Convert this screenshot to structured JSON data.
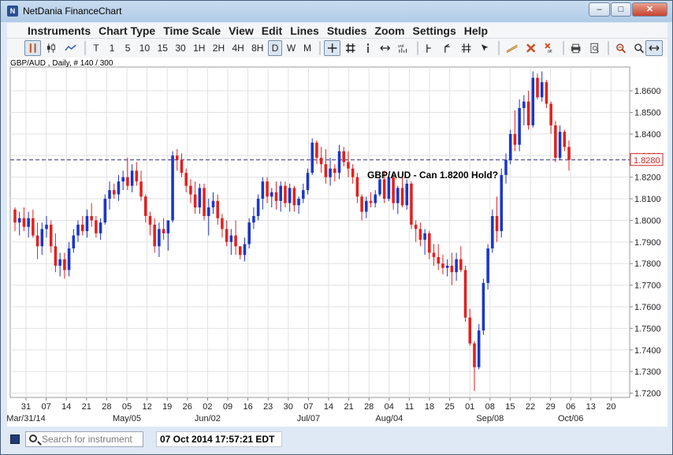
{
  "window": {
    "title": "NetDania FinanceChart",
    "controls": {
      "minimize": "–",
      "maximize": "□",
      "close": "✕"
    }
  },
  "menu": {
    "items": [
      "Instruments",
      "Chart Type",
      "Time Scale",
      "View",
      "Edit",
      "Lines",
      "Studies",
      "Zoom",
      "Settings",
      "Help"
    ]
  },
  "toolbar": {
    "chart_types": [
      "bar-chart-icon",
      "candlestick-icon",
      "line-chart-icon"
    ],
    "timescales": [
      "T",
      "1",
      "5",
      "10",
      "15",
      "30",
      "1H",
      "2H",
      "4H",
      "8H",
      "D",
      "W",
      "M"
    ],
    "active_timescale": "D",
    "tools": [
      "crosshair-icon",
      "grid-icon",
      "info-icon",
      "pan-icon",
      "volume-icon",
      "line-tool-icon",
      "fork-tool-icon",
      "fib-tool-icon",
      "cursor-tool-icon",
      "trendline-icon",
      "delete-icon",
      "delete-all-icon",
      "print-icon",
      "print-preview-icon",
      "zoom-out-icon",
      "zoom-reset-icon",
      "zoom-in-icon",
      "expand-icon"
    ]
  },
  "chart_header": "GBP/AUD , Daily, # 140 / 300",
  "status": {
    "search_placeholder": "Search for instrument",
    "timestamp": "07 Oct 2014 17:57:21 EDT"
  },
  "chart_data": {
    "type": "candlestick",
    "instrument": "GBP/AUD",
    "annotation": "GBP/AUD - Can 1.8200 Hold?",
    "last_price": "1.8280",
    "ylim": [
      1.718,
      1.871
    ],
    "yticks": [
      "1.7200",
      "1.7300",
      "1.7400",
      "1.7500",
      "1.7600",
      "1.7700",
      "1.7800",
      "1.7900",
      "1.8000",
      "1.8100",
      "1.8200",
      "1.8300",
      "1.8400",
      "1.8500",
      "1.8600"
    ],
    "xticks": [
      "31",
      "07",
      "14",
      "21",
      "28",
      "05",
      "12",
      "19",
      "26",
      "02",
      "09",
      "16",
      "23",
      "30",
      "07",
      "14",
      "21",
      "28",
      "04",
      "11",
      "18",
      "25",
      "01",
      "08",
      "15",
      "22",
      "29",
      "06",
      "13",
      "20"
    ],
    "month_labels": [
      {
        "label": "Mar/31/14",
        "tick_index": 0
      },
      {
        "label": "May/05",
        "tick_index": 5
      },
      {
        "label": "Jun/02",
        "tick_index": 9
      },
      {
        "label": "Jul/07",
        "tick_index": 14
      },
      {
        "label": "Aug/04",
        "tick_index": 18
      },
      {
        "label": "Sep/08",
        "tick_index": 23
      },
      {
        "label": "Oct/06",
        "tick_index": 27
      }
    ],
    "horizontal_line": 1.828,
    "candles": [
      [
        1.805,
        1.806,
        1.795,
        1.799
      ],
      [
        1.799,
        1.804,
        1.793,
        1.801
      ],
      [
        1.801,
        1.806,
        1.795,
        1.797
      ],
      [
        1.797,
        1.804,
        1.792,
        1.801
      ],
      [
        1.801,
        1.805,
        1.792,
        1.793
      ],
      [
        1.793,
        1.799,
        1.782,
        1.788
      ],
      [
        1.788,
        1.799,
        1.784,
        1.796
      ],
      [
        1.796,
        1.802,
        1.792,
        1.798
      ],
      [
        1.798,
        1.8,
        1.785,
        1.788
      ],
      [
        1.788,
        1.794,
        1.776,
        1.779
      ],
      [
        1.779,
        1.785,
        1.774,
        1.782
      ],
      [
        1.782,
        1.785,
        1.773,
        1.777
      ],
      [
        1.777,
        1.79,
        1.774,
        1.787
      ],
      [
        1.787,
        1.796,
        1.785,
        1.793
      ],
      [
        1.793,
        1.8,
        1.79,
        1.798
      ],
      [
        1.798,
        1.802,
        1.793,
        1.795
      ],
      [
        1.795,
        1.805,
        1.792,
        1.802
      ],
      [
        1.802,
        1.808,
        1.797,
        1.8
      ],
      [
        1.8,
        1.802,
        1.792,
        1.794
      ],
      [
        1.794,
        1.801,
        1.791,
        1.799
      ],
      [
        1.799,
        1.812,
        1.798,
        1.81
      ],
      [
        1.81,
        1.818,
        1.805,
        1.814
      ],
      [
        1.814,
        1.817,
        1.81,
        1.812
      ],
      [
        1.812,
        1.821,
        1.809,
        1.818
      ],
      [
        1.818,
        1.823,
        1.814,
        1.82
      ],
      [
        1.82,
        1.829,
        1.814,
        1.816
      ],
      [
        1.816,
        1.826,
        1.813,
        1.823
      ],
      [
        1.823,
        1.827,
        1.816,
        1.818
      ],
      [
        1.818,
        1.823,
        1.809,
        1.811
      ],
      [
        1.811,
        1.812,
        1.799,
        1.802
      ],
      [
        1.802,
        1.804,
        1.793,
        1.798
      ],
      [
        1.798,
        1.801,
        1.785,
        1.788
      ],
      [
        1.788,
        1.799,
        1.783,
        1.796
      ],
      [
        1.796,
        1.801,
        1.791,
        1.794
      ],
      [
        1.794,
        1.798,
        1.786,
        1.8
      ],
      [
        1.8,
        1.832,
        1.799,
        1.83
      ],
      [
        1.83,
        1.833,
        1.823,
        1.828
      ],
      [
        1.828,
        1.831,
        1.82,
        1.822
      ],
      [
        1.822,
        1.824,
        1.813,
        1.816
      ],
      [
        1.816,
        1.819,
        1.808,
        1.812
      ],
      [
        1.812,
        1.818,
        1.803,
        1.806
      ],
      [
        1.806,
        1.817,
        1.803,
        1.815
      ],
      [
        1.815,
        1.817,
        1.8,
        1.802
      ],
      [
        1.802,
        1.81,
        1.793,
        1.806
      ],
      [
        1.806,
        1.813,
        1.803,
        1.809
      ],
      [
        1.809,
        1.812,
        1.798,
        1.801
      ],
      [
        1.801,
        1.803,
        1.792,
        1.796
      ],
      [
        1.796,
        1.8,
        1.788,
        1.79
      ],
      [
        1.79,
        1.796,
        1.784,
        1.793
      ],
      [
        1.793,
        1.8,
        1.784,
        1.788
      ],
      [
        1.788,
        1.788,
        1.782,
        1.784
      ],
      [
        1.784,
        1.792,
        1.781,
        1.789
      ],
      [
        1.789,
        1.801,
        1.787,
        1.799
      ],
      [
        1.799,
        1.806,
        1.796,
        1.802
      ],
      [
        1.802,
        1.812,
        1.8,
        1.81
      ],
      [
        1.81,
        1.82,
        1.805,
        1.818
      ],
      [
        1.818,
        1.82,
        1.808,
        1.811
      ],
      [
        1.811,
        1.815,
        1.806,
        1.813
      ],
      [
        1.813,
        1.818,
        1.805,
        1.809
      ],
      [
        1.809,
        1.818,
        1.804,
        1.816
      ],
      [
        1.816,
        1.818,
        1.806,
        1.808
      ],
      [
        1.808,
        1.817,
        1.804,
        1.815
      ],
      [
        1.815,
        1.816,
        1.804,
        1.807
      ],
      [
        1.807,
        1.811,
        1.803,
        1.81
      ],
      [
        1.81,
        1.817,
        1.808,
        1.814
      ],
      [
        1.814,
        1.824,
        1.812,
        1.822
      ],
      [
        1.822,
        1.838,
        1.821,
        1.836
      ],
      [
        1.836,
        1.837,
        1.826,
        1.829
      ],
      [
        1.829,
        1.834,
        1.822,
        1.826
      ],
      [
        1.826,
        1.833,
        1.817,
        1.82
      ],
      [
        1.82,
        1.829,
        1.816,
        1.824
      ],
      [
        1.824,
        1.826,
        1.818,
        1.822
      ],
      [
        1.822,
        1.835,
        1.819,
        1.832
      ],
      [
        1.832,
        1.834,
        1.825,
        1.827
      ],
      [
        1.827,
        1.832,
        1.82,
        1.824
      ],
      [
        1.824,
        1.826,
        1.817,
        1.82
      ],
      [
        1.82,
        1.822,
        1.808,
        1.811
      ],
      [
        1.811,
        1.812,
        1.8,
        1.804
      ],
      [
        1.804,
        1.811,
        1.801,
        1.809
      ],
      [
        1.809,
        1.813,
        1.806,
        1.808
      ],
      [
        1.808,
        1.814,
        1.806,
        1.812
      ],
      [
        1.812,
        1.821,
        1.811,
        1.819
      ],
      [
        1.819,
        1.823,
        1.808,
        1.81
      ],
      [
        1.81,
        1.821,
        1.809,
        1.82
      ],
      [
        1.82,
        1.822,
        1.805,
        1.808
      ],
      [
        1.808,
        1.816,
        1.803,
        1.815
      ],
      [
        1.815,
        1.82,
        1.806,
        1.807
      ],
      [
        1.807,
        1.819,
        1.805,
        1.817
      ],
      [
        1.817,
        1.818,
        1.796,
        1.798
      ],
      [
        1.798,
        1.8,
        1.79,
        1.796
      ],
      [
        1.796,
        1.799,
        1.788,
        1.791
      ],
      [
        1.791,
        1.796,
        1.784,
        1.794
      ],
      [
        1.794,
        1.795,
        1.782,
        1.785
      ],
      [
        1.785,
        1.789,
        1.779,
        1.783
      ],
      [
        1.783,
        1.789,
        1.777,
        1.78
      ],
      [
        1.78,
        1.784,
        1.775,
        1.778
      ],
      [
        1.778,
        1.782,
        1.774,
        1.779
      ],
      [
        1.779,
        1.785,
        1.77,
        1.776
      ],
      [
        1.776,
        1.785,
        1.772,
        1.782
      ],
      [
        1.782,
        1.788,
        1.776,
        1.777
      ],
      [
        1.777,
        1.779,
        1.753,
        1.755
      ],
      [
        1.755,
        1.759,
        1.742,
        1.743
      ],
      [
        1.743,
        1.744,
        1.721,
        1.732
      ],
      [
        1.732,
        1.752,
        1.731,
        1.749
      ],
      [
        1.749,
        1.773,
        1.747,
        1.771
      ],
      [
        1.771,
        1.789,
        1.768,
        1.787
      ],
      [
        1.787,
        1.805,
        1.785,
        1.802
      ],
      [
        1.802,
        1.811,
        1.79,
        1.795
      ],
      [
        1.795,
        1.824,
        1.792,
        1.821
      ],
      [
        1.821,
        1.831,
        1.817,
        1.828
      ],
      [
        1.828,
        1.842,
        1.826,
        1.84
      ],
      [
        1.84,
        1.851,
        1.832,
        1.835
      ],
      [
        1.835,
        1.856,
        1.832,
        1.852
      ],
      [
        1.852,
        1.858,
        1.844,
        1.855
      ],
      [
        1.855,
        1.86,
        1.842,
        1.844
      ],
      [
        1.844,
        1.869,
        1.843,
        1.866
      ],
      [
        1.866,
        1.868,
        1.856,
        1.857
      ],
      [
        1.857,
        1.869,
        1.855,
        1.864
      ],
      [
        1.864,
        1.865,
        1.852,
        1.854
      ],
      [
        1.854,
        1.855,
        1.84,
        1.844
      ],
      [
        1.844,
        1.846,
        1.827,
        1.829
      ],
      [
        1.829,
        1.844,
        1.828,
        1.841
      ],
      [
        1.841,
        1.842,
        1.832,
        1.834
      ],
      [
        1.834,
        1.837,
        1.823,
        1.828
      ]
    ]
  }
}
